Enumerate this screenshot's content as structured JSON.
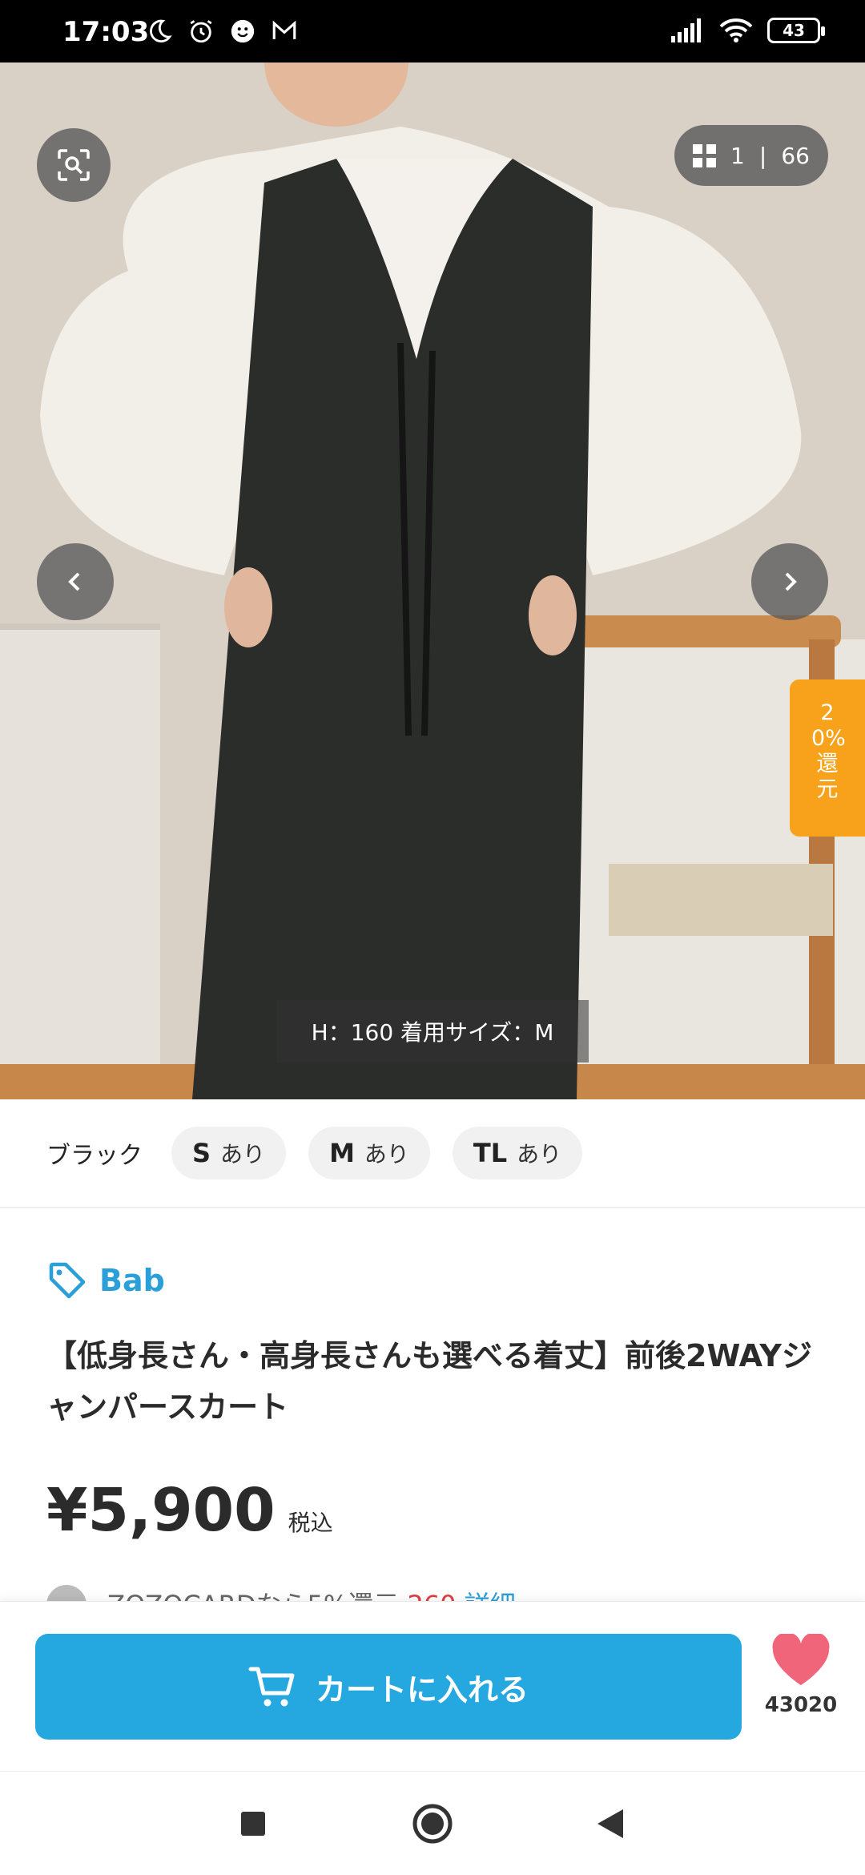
{
  "status_bar": {
    "time": "17:03",
    "battery": "43",
    "icons_left": [
      "moon-icon",
      "alarm-icon",
      "face-icon",
      "mail-icon"
    ],
    "icons_right": [
      "signal-icon",
      "wifi-icon",
      "battery-icon"
    ]
  },
  "gallery": {
    "current": "1",
    "separator": "|",
    "total": "66",
    "caption": "H：160 着用サイズ：M",
    "rebate_label": "20%還元"
  },
  "variant": {
    "color": "ブラック",
    "sizes": [
      {
        "size": "S",
        "availability": "あり"
      },
      {
        "size": "M",
        "availability": "あり"
      },
      {
        "size": "TL",
        "availability": "あり"
      }
    ]
  },
  "product": {
    "brand": "Bab",
    "title": "【低身長さん・高身長さんも選べる着丈】前後2WAYジャンパースカート",
    "price": "¥5,900",
    "tax_label": "税込",
    "card_line": {
      "text": "ZOZOCARDなら5%還元",
      "points": "260",
      "detail": "詳細"
    }
  },
  "actions": {
    "cart_label": "カートに入れる",
    "favorite_count": "43020"
  },
  "colors": {
    "accent_blue": "#25a8e0",
    "brand_blue": "#2a9fd8",
    "rebate_orange": "#f7a21a",
    "favorite_pink": "#f0657a"
  }
}
